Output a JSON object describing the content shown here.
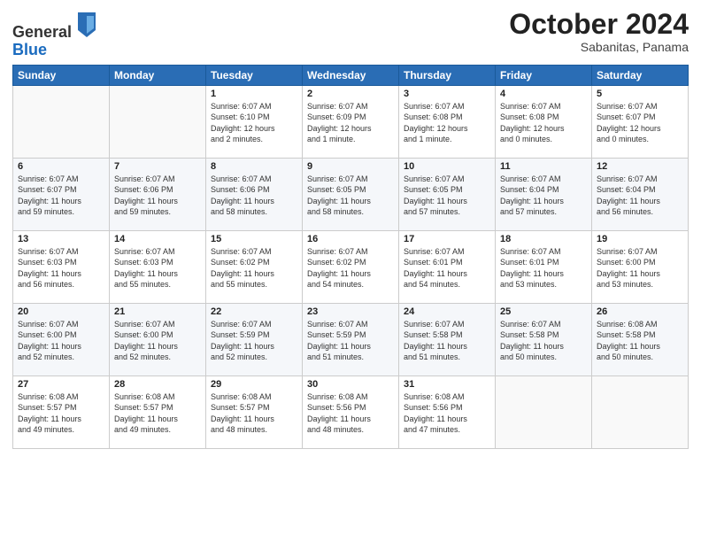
{
  "logo": {
    "general": "General",
    "blue": "Blue"
  },
  "header": {
    "month": "October 2024",
    "location": "Sabanitas, Panama"
  },
  "weekdays": [
    "Sunday",
    "Monday",
    "Tuesday",
    "Wednesday",
    "Thursday",
    "Friday",
    "Saturday"
  ],
  "weeks": [
    [
      {
        "day": "",
        "info": ""
      },
      {
        "day": "",
        "info": ""
      },
      {
        "day": "1",
        "info": "Sunrise: 6:07 AM\nSunset: 6:10 PM\nDaylight: 12 hours\nand 2 minutes."
      },
      {
        "day": "2",
        "info": "Sunrise: 6:07 AM\nSunset: 6:09 PM\nDaylight: 12 hours\nand 1 minute."
      },
      {
        "day": "3",
        "info": "Sunrise: 6:07 AM\nSunset: 6:08 PM\nDaylight: 12 hours\nand 1 minute."
      },
      {
        "day": "4",
        "info": "Sunrise: 6:07 AM\nSunset: 6:08 PM\nDaylight: 12 hours\nand 0 minutes."
      },
      {
        "day": "5",
        "info": "Sunrise: 6:07 AM\nSunset: 6:07 PM\nDaylight: 12 hours\nand 0 minutes."
      }
    ],
    [
      {
        "day": "6",
        "info": "Sunrise: 6:07 AM\nSunset: 6:07 PM\nDaylight: 11 hours\nand 59 minutes."
      },
      {
        "day": "7",
        "info": "Sunrise: 6:07 AM\nSunset: 6:06 PM\nDaylight: 11 hours\nand 59 minutes."
      },
      {
        "day": "8",
        "info": "Sunrise: 6:07 AM\nSunset: 6:06 PM\nDaylight: 11 hours\nand 58 minutes."
      },
      {
        "day": "9",
        "info": "Sunrise: 6:07 AM\nSunset: 6:05 PM\nDaylight: 11 hours\nand 58 minutes."
      },
      {
        "day": "10",
        "info": "Sunrise: 6:07 AM\nSunset: 6:05 PM\nDaylight: 11 hours\nand 57 minutes."
      },
      {
        "day": "11",
        "info": "Sunrise: 6:07 AM\nSunset: 6:04 PM\nDaylight: 11 hours\nand 57 minutes."
      },
      {
        "day": "12",
        "info": "Sunrise: 6:07 AM\nSunset: 6:04 PM\nDaylight: 11 hours\nand 56 minutes."
      }
    ],
    [
      {
        "day": "13",
        "info": "Sunrise: 6:07 AM\nSunset: 6:03 PM\nDaylight: 11 hours\nand 56 minutes."
      },
      {
        "day": "14",
        "info": "Sunrise: 6:07 AM\nSunset: 6:03 PM\nDaylight: 11 hours\nand 55 minutes."
      },
      {
        "day": "15",
        "info": "Sunrise: 6:07 AM\nSunset: 6:02 PM\nDaylight: 11 hours\nand 55 minutes."
      },
      {
        "day": "16",
        "info": "Sunrise: 6:07 AM\nSunset: 6:02 PM\nDaylight: 11 hours\nand 54 minutes."
      },
      {
        "day": "17",
        "info": "Sunrise: 6:07 AM\nSunset: 6:01 PM\nDaylight: 11 hours\nand 54 minutes."
      },
      {
        "day": "18",
        "info": "Sunrise: 6:07 AM\nSunset: 6:01 PM\nDaylight: 11 hours\nand 53 minutes."
      },
      {
        "day": "19",
        "info": "Sunrise: 6:07 AM\nSunset: 6:00 PM\nDaylight: 11 hours\nand 53 minutes."
      }
    ],
    [
      {
        "day": "20",
        "info": "Sunrise: 6:07 AM\nSunset: 6:00 PM\nDaylight: 11 hours\nand 52 minutes."
      },
      {
        "day": "21",
        "info": "Sunrise: 6:07 AM\nSunset: 6:00 PM\nDaylight: 11 hours\nand 52 minutes."
      },
      {
        "day": "22",
        "info": "Sunrise: 6:07 AM\nSunset: 5:59 PM\nDaylight: 11 hours\nand 52 minutes."
      },
      {
        "day": "23",
        "info": "Sunrise: 6:07 AM\nSunset: 5:59 PM\nDaylight: 11 hours\nand 51 minutes."
      },
      {
        "day": "24",
        "info": "Sunrise: 6:07 AM\nSunset: 5:58 PM\nDaylight: 11 hours\nand 51 minutes."
      },
      {
        "day": "25",
        "info": "Sunrise: 6:07 AM\nSunset: 5:58 PM\nDaylight: 11 hours\nand 50 minutes."
      },
      {
        "day": "26",
        "info": "Sunrise: 6:08 AM\nSunset: 5:58 PM\nDaylight: 11 hours\nand 50 minutes."
      }
    ],
    [
      {
        "day": "27",
        "info": "Sunrise: 6:08 AM\nSunset: 5:57 PM\nDaylight: 11 hours\nand 49 minutes."
      },
      {
        "day": "28",
        "info": "Sunrise: 6:08 AM\nSunset: 5:57 PM\nDaylight: 11 hours\nand 49 minutes."
      },
      {
        "day": "29",
        "info": "Sunrise: 6:08 AM\nSunset: 5:57 PM\nDaylight: 11 hours\nand 48 minutes."
      },
      {
        "day": "30",
        "info": "Sunrise: 6:08 AM\nSunset: 5:56 PM\nDaylight: 11 hours\nand 48 minutes."
      },
      {
        "day": "31",
        "info": "Sunrise: 6:08 AM\nSunset: 5:56 PM\nDaylight: 11 hours\nand 47 minutes."
      },
      {
        "day": "",
        "info": ""
      },
      {
        "day": "",
        "info": ""
      }
    ]
  ]
}
